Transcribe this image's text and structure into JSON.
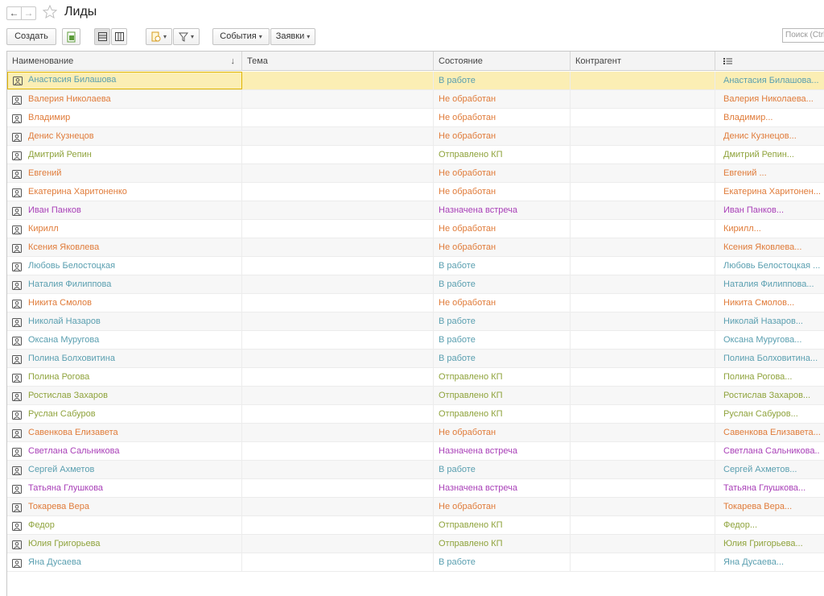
{
  "window": {
    "title": "Лиды"
  },
  "toolbar": {
    "create_label": "Создать",
    "events_label": "События",
    "requests_label": "Заявки",
    "search_placeholder": "Поиск (Ctrl+F)"
  },
  "columns": {
    "name": "Наименование",
    "theme": "Тема",
    "state": "Состояние",
    "counterparty": "Контрагент"
  },
  "colors": {
    "in_work": "#5a9fb0",
    "not_processed": "#e07b39",
    "sent_kp": "#8fa33c",
    "meeting": "#a940b8",
    "selection": "#fbeeb4"
  },
  "rows": [
    {
      "name": "Анастасия Билашова",
      "state": "В работе",
      "extra": "Анастасия Билашова...",
      "color": "#5a9fb0",
      "selected": true
    },
    {
      "name": "Валерия Николаева",
      "state": "Не обработан",
      "extra": "Валерия Николаева...",
      "color": "#e07b39"
    },
    {
      "name": "Владимир",
      "state": "Не обработан",
      "extra": "Владимир...",
      "color": "#e07b39"
    },
    {
      "name": "Денис Кузнецов",
      "state": "Не обработан",
      "extra": "Денис Кузнецов...",
      "color": "#e07b39"
    },
    {
      "name": "Дмитрий Репин",
      "state": "Отправлено КП",
      "extra": "Дмитрий Репин...",
      "color": "#8fa33c"
    },
    {
      "name": "Евгений",
      "state": "Не обработан",
      "extra": "Евгений ...",
      "color": "#e07b39"
    },
    {
      "name": "Екатерина Харитоненко",
      "state": "Не обработан",
      "extra": "Екатерина Харитонен...",
      "color": "#e07b39"
    },
    {
      "name": "Иван Панков",
      "state": "Назначена встреча",
      "extra": "Иван Панков...",
      "color": "#a940b8"
    },
    {
      "name": "Кирилл",
      "state": "Не обработан",
      "extra": "Кирилл...",
      "color": "#e07b39"
    },
    {
      "name": "Ксения Яковлева",
      "state": "Не обработан",
      "extra": "Ксения Яковлева...",
      "color": "#e07b39"
    },
    {
      "name": "Любовь Белостоцкая",
      "state": "В работе",
      "extra": "Любовь Белостоцкая ...",
      "color": "#5a9fb0"
    },
    {
      "name": "Наталия Филиппова",
      "state": "В работе",
      "extra": "Наталия Филиппова...",
      "color": "#5a9fb0"
    },
    {
      "name": "Никита Смолов",
      "state": "Не обработан",
      "extra": "Никита Смолов...",
      "color": "#e07b39"
    },
    {
      "name": "Николай Назаров",
      "state": "В работе",
      "extra": "Николай Назаров...",
      "color": "#5a9fb0"
    },
    {
      "name": "Оксана Муругова",
      "state": "В работе",
      "extra": "Оксана Муругова...",
      "color": "#5a9fb0"
    },
    {
      "name": "Полина Болховитина",
      "state": "В работе",
      "extra": "Полина Болховитина...",
      "color": "#5a9fb0"
    },
    {
      "name": "Полина Рогова",
      "state": "Отправлено КП",
      "extra": "Полина Рогова...",
      "color": "#8fa33c"
    },
    {
      "name": "Ростислав Захаров",
      "state": "Отправлено КП",
      "extra": "Ростислав Захаров...",
      "color": "#8fa33c"
    },
    {
      "name": "Руслан Сабуров",
      "state": "Отправлено КП",
      "extra": "Руслан Сабуров...",
      "color": "#8fa33c"
    },
    {
      "name": "Савенкова Елизавета",
      "state": "Не обработан",
      "extra": "Савенкова Елизавета...",
      "color": "#e07b39"
    },
    {
      "name": "Светлана Сальникова",
      "state": "Назначена встреча",
      "extra": "Светлана Сальникова...",
      "color": "#a940b8"
    },
    {
      "name": "Сергей Ахметов",
      "state": "В работе",
      "extra": "Сергей Ахметов...",
      "color": "#5a9fb0"
    },
    {
      "name": "Татьяна Глушкова",
      "state": "Назначена встреча",
      "extra": "Татьяна Глушкова...",
      "color": "#a940b8"
    },
    {
      "name": "Токарева Вера",
      "state": "Не обработан",
      "extra": "Токарева Вера...",
      "color": "#e07b39"
    },
    {
      "name": "Федор",
      "state": "Отправлено КП",
      "extra": "Федор...",
      "color": "#8fa33c"
    },
    {
      "name": "Юлия Григорьева",
      "state": "Отправлено КП",
      "extra": "Юлия Григорьева...",
      "color": "#8fa33c"
    },
    {
      "name": "Яна Дусаева",
      "state": "В работе",
      "extra": "Яна Дусаева...",
      "color": "#5a9fb0"
    }
  ]
}
